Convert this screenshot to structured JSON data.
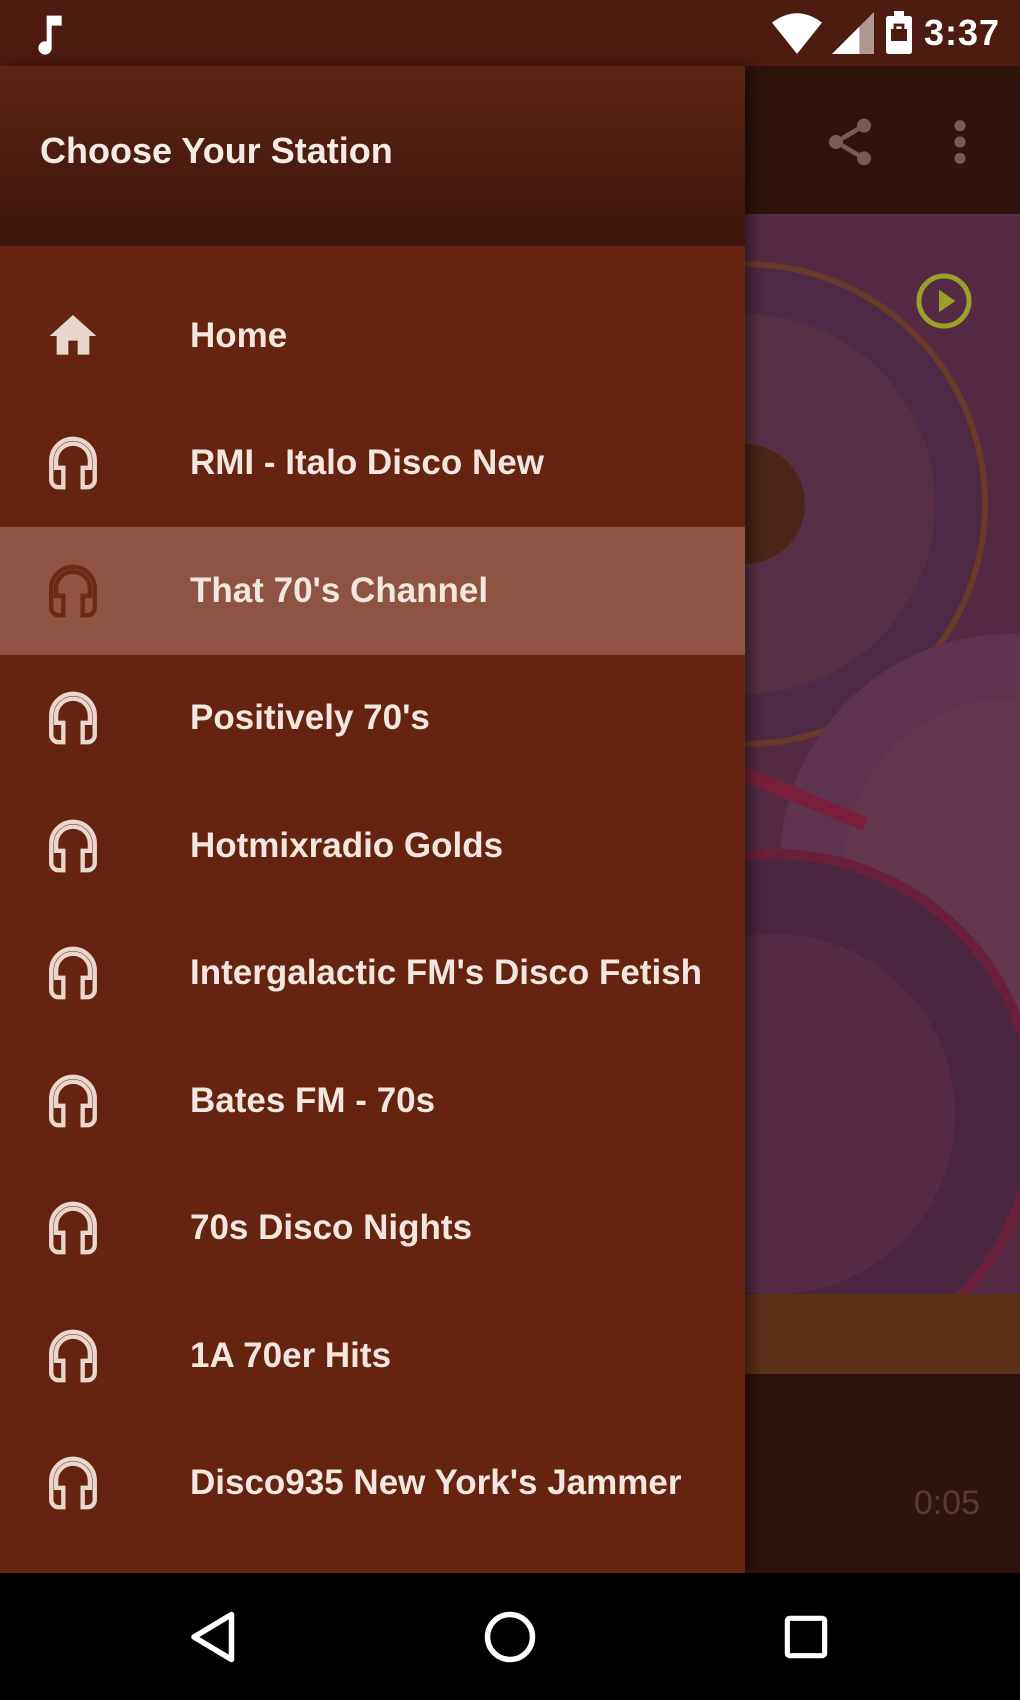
{
  "status_bar": {
    "time": "3:37",
    "icons": [
      "music-note-icon",
      "wifi-icon",
      "signal-icon",
      "battery-icon"
    ]
  },
  "drawer": {
    "title": "Choose Your Station",
    "items": [
      {
        "label": "Home",
        "icon": "home-icon",
        "selected": false
      },
      {
        "label": "RMI - Italo Disco New",
        "icon": "headphones-icon",
        "selected": false
      },
      {
        "label": "That 70's Channel",
        "icon": "headphones-icon",
        "selected": true
      },
      {
        "label": "Positively 70's",
        "icon": "headphones-icon",
        "selected": false
      },
      {
        "label": "Hotmixradio Golds",
        "icon": "headphones-icon",
        "selected": false
      },
      {
        "label": "Intergalactic FM's Disco Fetish",
        "icon": "headphones-icon",
        "selected": false
      },
      {
        "label": "Bates FM - 70s",
        "icon": "headphones-icon",
        "selected": false
      },
      {
        "label": "70s Disco Nights",
        "icon": "headphones-icon",
        "selected": false
      },
      {
        "label": "1A 70er Hits",
        "icon": "headphones-icon",
        "selected": false
      },
      {
        "label": "Disco935 New York's Jammer",
        "icon": "headphones-icon",
        "selected": false
      }
    ]
  },
  "background_app": {
    "toolbar_icons": [
      "share-icon",
      "overflow-menu-icon"
    ],
    "play_icon": "play-circle-icon",
    "elapsed_time": "0:05"
  },
  "nav_bar": {
    "buttons": [
      "back-icon",
      "home-circle-icon",
      "recents-icon"
    ]
  },
  "colors": {
    "drawer_bg": "#662410",
    "drawer_header": "#4a1c0f",
    "selected_row": "#8e5342",
    "status_bar": "#4d1b10",
    "play_accent": "#9aa12a"
  }
}
